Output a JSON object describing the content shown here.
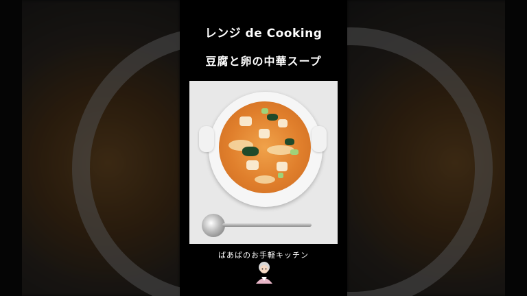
{
  "video": {
    "title_line1": "レンジ de Cooking",
    "title_line2": "豆腐と卵の中華スープ",
    "channel_name": "ばあばのお手軽キッチン"
  },
  "thumbnail": {
    "subject": "tofu-egg-chinese-soup-bowl-with-spoon",
    "avatar_icon": "grandma-avatar-icon"
  }
}
